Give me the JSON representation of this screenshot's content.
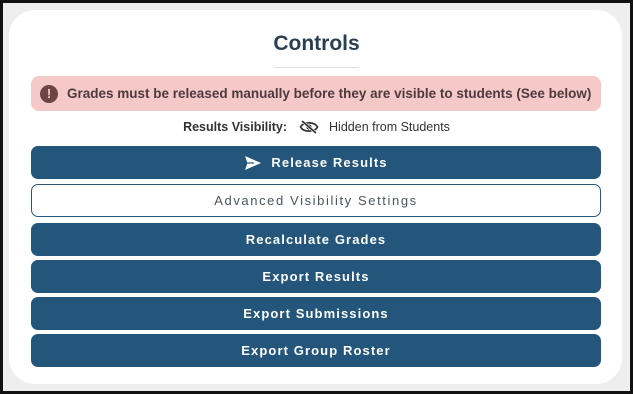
{
  "panel": {
    "title": "Controls"
  },
  "alert": {
    "icon": "exclamation-circle-icon",
    "text": "Grades must be released manually before they are visible to students (See below)"
  },
  "visibility": {
    "label": "Results Visibility:",
    "icon": "eye-slash-icon",
    "value": "Hidden from Students"
  },
  "buttons": {
    "release": {
      "label": "Release Results",
      "icon": "send-icon"
    },
    "advanced": {
      "label": "Advanced Visibility Settings"
    },
    "recalculate": {
      "label": "Recalculate Grades"
    },
    "export_results": {
      "label": "Export Results"
    },
    "export_submissions": {
      "label": "Export Submissions"
    },
    "export_roster": {
      "label": "Export Group Roster"
    }
  },
  "colors": {
    "primary": "#24557a",
    "alert_bg": "#f6c9c9",
    "title": "#2b3f52"
  }
}
